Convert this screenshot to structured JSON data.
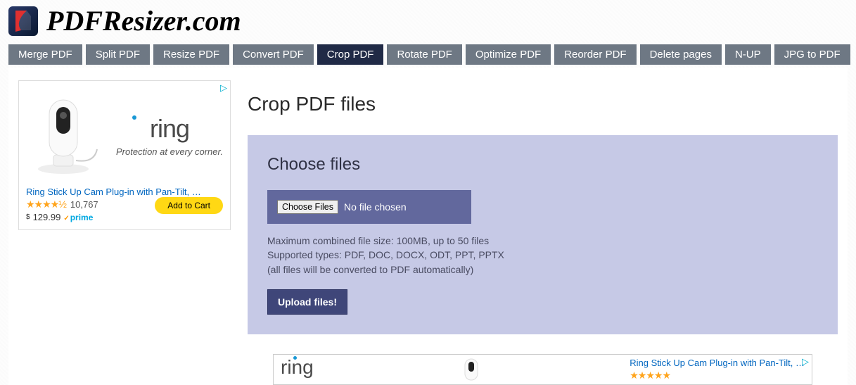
{
  "header": {
    "site_title": "PDFResizer.com"
  },
  "nav": {
    "items": [
      {
        "label": "Merge PDF",
        "active": false
      },
      {
        "label": "Split PDF",
        "active": false
      },
      {
        "label": "Resize PDF",
        "active": false
      },
      {
        "label": "Convert PDF",
        "active": false
      },
      {
        "label": "Crop PDF",
        "active": true
      },
      {
        "label": "Rotate PDF",
        "active": false
      },
      {
        "label": "Optimize PDF",
        "active": false
      },
      {
        "label": "Reorder PDF",
        "active": false
      },
      {
        "label": "Delete pages",
        "active": false
      },
      {
        "label": "N-UP",
        "active": false
      },
      {
        "label": "JPG to PDF",
        "active": false
      }
    ]
  },
  "ad": {
    "brand": "ring",
    "tagline": "Protection at every corner.",
    "product_title": "Ring Stick Up Cam Plug-in with Pan-Tilt, …",
    "stars": "★★★★½",
    "review_count": "10,767",
    "currency": "$",
    "price": "129.99",
    "prime": "prime",
    "cart_label": "Add to Cart",
    "adchoices_glyph": "▷"
  },
  "main": {
    "page_title": "Crop PDF files",
    "choose_title": "Choose files",
    "choose_button": "Choose Files",
    "no_file_text": "No file chosen",
    "hint1": "Maximum combined file size: 100MB, up to 50 files",
    "hint2": "Supported types: PDF, DOC, DOCX, ODT, PPT, PPTX",
    "hint3": "(all files will be converted to PDF automatically)",
    "upload_label": "Upload files!"
  },
  "banner": {
    "brand": "ring",
    "product_title": "Ring Stick Up Cam Plug-in with Pan-Tilt, …",
    "stars": "★★★★★",
    "adchoices_glyph": "▷"
  }
}
